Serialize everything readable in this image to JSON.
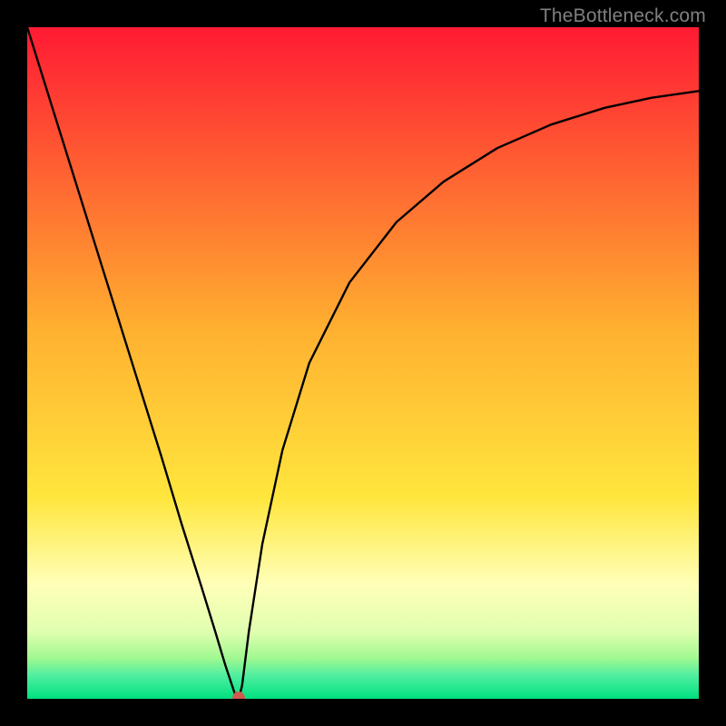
{
  "watermark": "TheBottleneck.com",
  "colors": {
    "frame": "#000000",
    "red": "#ff1a33",
    "orange": "#ff9a2a",
    "yellow": "#ffe63d",
    "pale_yellow": "#ffffb8",
    "green_mid": "#70f070",
    "green": "#00e080",
    "curve": "#000000",
    "marker": "#d15a4e"
  },
  "chart_data": {
    "type": "line",
    "title": "",
    "xlabel": "",
    "ylabel": "",
    "xlim": [
      0,
      100
    ],
    "ylim": [
      0,
      100
    ],
    "x": [
      0,
      5,
      10,
      15,
      20,
      23,
      26,
      28,
      29.5,
      30.5,
      31,
      31.5,
      32,
      33,
      35,
      38,
      42,
      48,
      55,
      62,
      70,
      78,
      86,
      93,
      100
    ],
    "values": [
      100,
      84,
      68,
      52,
      36,
      26,
      16.5,
      10,
      5,
      2,
      0.5,
      0,
      2,
      10,
      23,
      37,
      50,
      62,
      71,
      77,
      82,
      85.5,
      88,
      89.5,
      90.5
    ],
    "marker": {
      "x": 31.5,
      "y": 0
    },
    "gradient_stops": [
      {
        "pos": 0.0,
        "color": "#ff1a33"
      },
      {
        "pos": 0.1,
        "color": "#ff3b33"
      },
      {
        "pos": 0.45,
        "color": "#ffb030"
      },
      {
        "pos": 0.7,
        "color": "#ffe63d"
      },
      {
        "pos": 0.83,
        "color": "#ffffb8"
      },
      {
        "pos": 0.9,
        "color": "#e0ffb0"
      },
      {
        "pos": 0.94,
        "color": "#a0f890"
      },
      {
        "pos": 0.965,
        "color": "#50efa0"
      },
      {
        "pos": 1.0,
        "color": "#00e080"
      }
    ]
  }
}
